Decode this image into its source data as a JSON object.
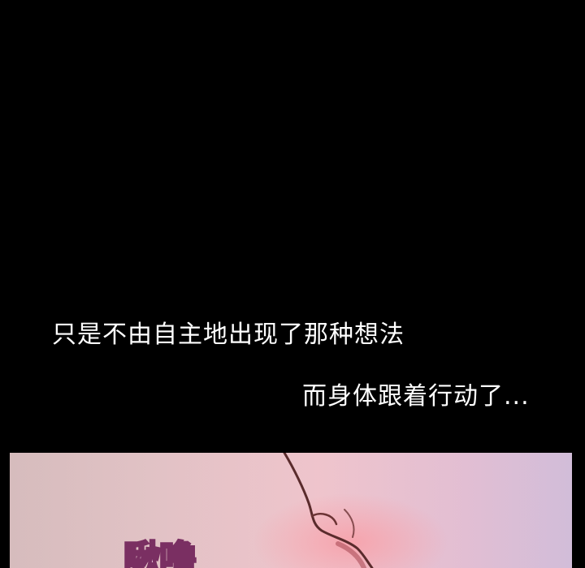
{
  "captions": {
    "line1": "只是不由自主地出现了那种想法",
    "line2": "而身体跟着行动了..."
  },
  "panel": {
    "sound_effect": "啾噜"
  },
  "colors": {
    "background": "#000000",
    "caption_text": "#ffffff",
    "sfx_fill": "#e9c5dc",
    "sfx_outline": "#7a2f62"
  }
}
